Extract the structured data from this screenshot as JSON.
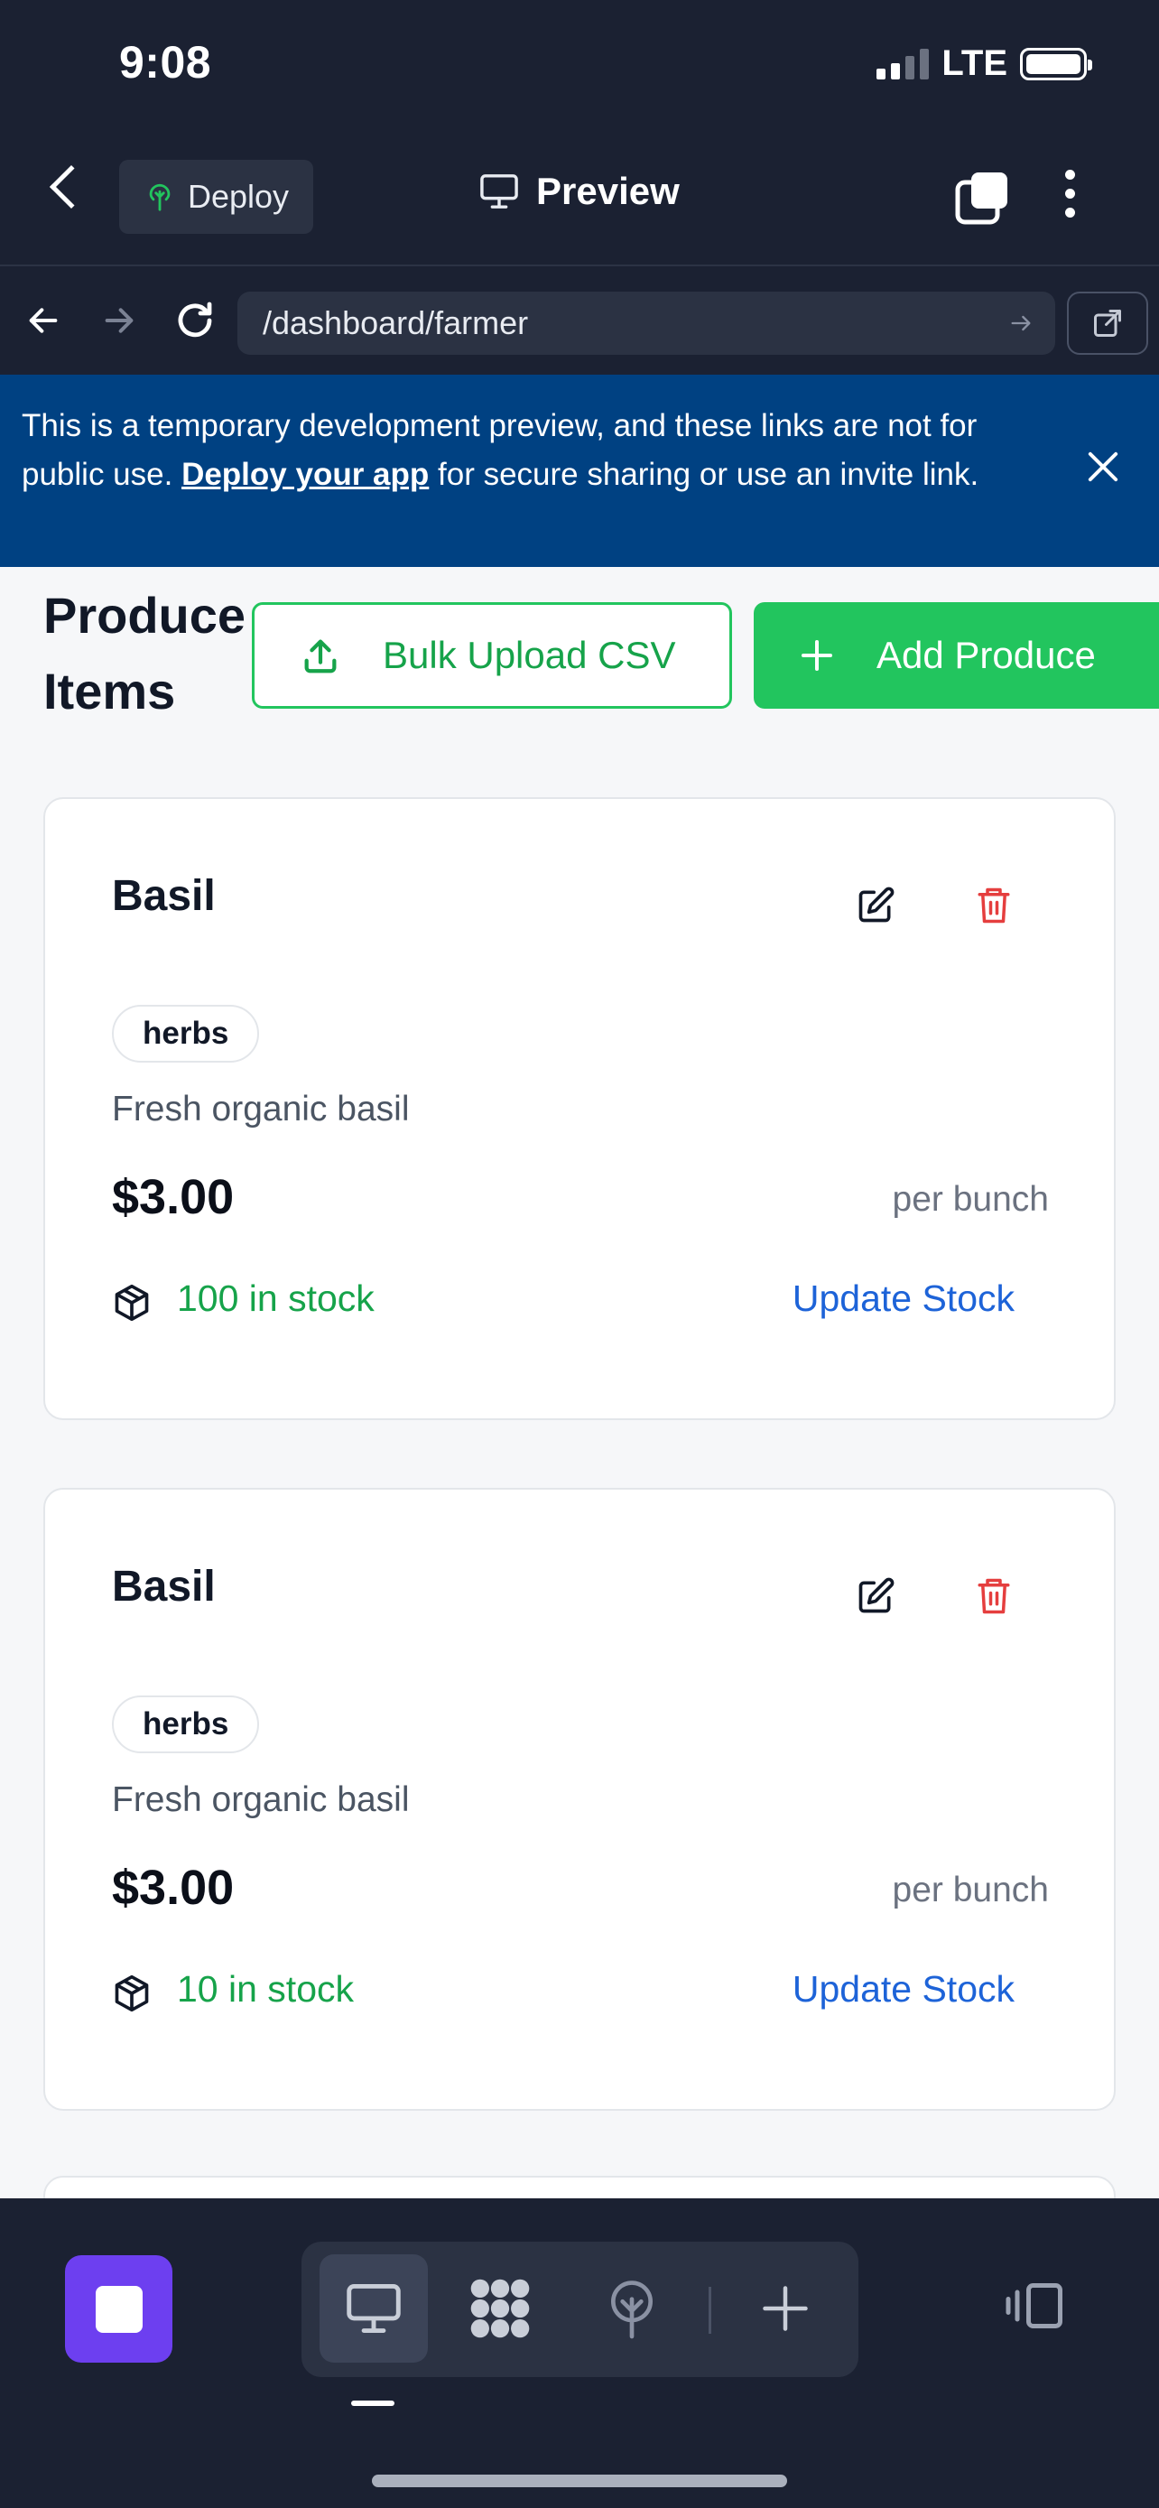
{
  "status_bar": {
    "time": "9:08",
    "network": "LTE"
  },
  "header": {
    "deploy_label": "Deploy",
    "title": "Preview"
  },
  "browser": {
    "url": "/dashboard/farmer"
  },
  "banner": {
    "text_before": "This is a temporary development preview, and these links are not for public use. ",
    "link": "Deploy your app",
    "text_after": " for secure sharing or use an invite link."
  },
  "page": {
    "heading": "Produce Items",
    "bulk_upload_label": "Bulk Upload CSV",
    "add_label": "Add Produce"
  },
  "products": [
    {
      "name": "Basil",
      "category": "herbs",
      "description": "Fresh organic basil",
      "price": "$3.00",
      "unit": "per bunch",
      "stock": "100 in stock",
      "update_label": "Update Stock"
    },
    {
      "name": "Basil",
      "category": "herbs",
      "description": "Fresh organic basil",
      "price": "$3.00",
      "unit": "per bunch",
      "stock": "10 in stock",
      "update_label": "Update Stock"
    }
  ],
  "colors": {
    "accent_green": "#22c55e",
    "banner_blue": "#004182",
    "link_blue": "#1d63d8",
    "danger_red": "#e53e3e",
    "chrome_dark": "#1b2132",
    "stop_purple": "#6d3ff0"
  },
  "icons": [
    "back-chevron-icon",
    "deploy-icon",
    "monitor-icon",
    "tabs-icon",
    "more-icon",
    "arrow-left-icon",
    "arrow-right-icon",
    "reload-icon",
    "go-icon",
    "external-link-icon",
    "upload-icon",
    "plus-icon",
    "edit-icon",
    "trash-icon",
    "package-icon",
    "stop-icon",
    "apps-icon",
    "deploy-tree-icon",
    "layout-icon"
  ]
}
